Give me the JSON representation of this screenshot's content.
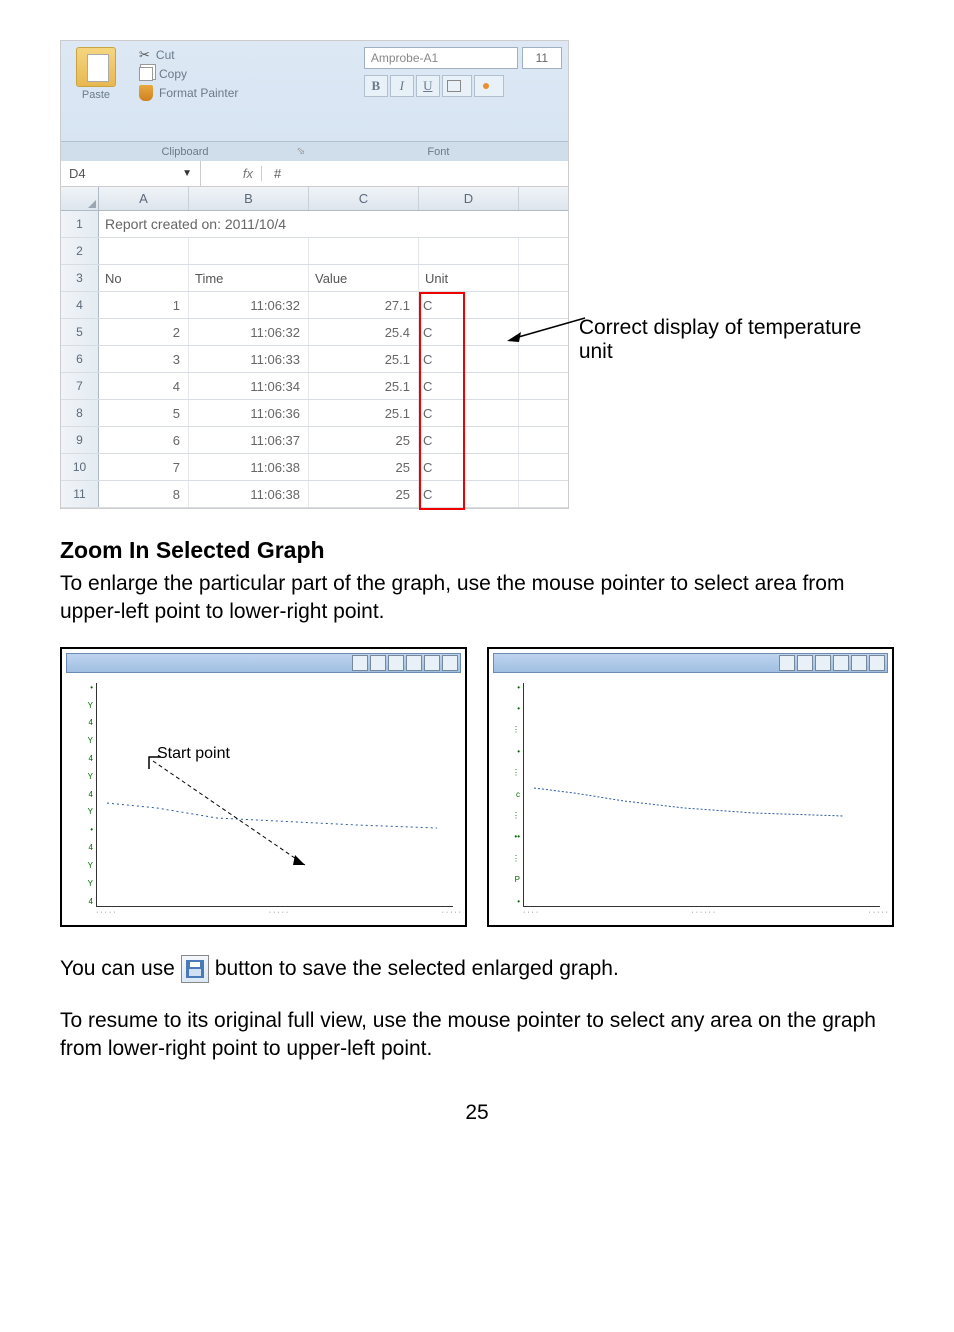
{
  "excel": {
    "ribbon": {
      "paste_label": "Paste",
      "cut_label": "Cut",
      "copy_label": "Copy",
      "format_painter_label": "Format Painter",
      "clipboard_group": "Clipboard",
      "font_group": "Font",
      "font_name": "Amprobe-A1",
      "font_size": "11",
      "bold": "B",
      "italic": "I",
      "underline": "U"
    },
    "namebox": "D4",
    "fx": "fx",
    "col_headers": [
      "A",
      "B",
      "C",
      "D"
    ],
    "row1_merged": "Report created on: 2011/10/4",
    "row3_headers": {
      "a": "No",
      "b": "Time",
      "c": "Value",
      "d": "Unit"
    },
    "rows": [
      {
        "no": "1",
        "time": "11:06:32",
        "value": "27.1",
        "unit": "C"
      },
      {
        "no": "2",
        "time": "11:06:32",
        "value": "25.4",
        "unit": "C"
      },
      {
        "no": "3",
        "time": "11:06:33",
        "value": "25.1",
        "unit": "C"
      },
      {
        "no": "4",
        "time": "11:06:34",
        "value": "25.1",
        "unit": "C"
      },
      {
        "no": "5",
        "time": "11:06:36",
        "value": "25.1",
        "unit": "C"
      },
      {
        "no": "6",
        "time": "11:06:37",
        "value": "25",
        "unit": "C"
      },
      {
        "no": "7",
        "time": "11:06:38",
        "value": "25",
        "unit": "C"
      },
      {
        "no": "8",
        "time": "11:06:38",
        "value": "25",
        "unit": "C"
      }
    ],
    "fx_value": "#"
  },
  "callout": "Correct display of temperature unit",
  "heading": "Zoom In Selected Graph",
  "para1": "To enlarge the particular part of the graph, use the mouse pointer to select area from upper-left point to lower-right point.",
  "start_point_label": "Start point",
  "save_line_before": "You can use",
  "save_line_after": "button to save the selected enlarged graph.",
  "para2": "To resume to its original full view, use the mouse pointer to select any area on the graph from lower-right point to upper-left point.",
  "page_number": "25"
}
